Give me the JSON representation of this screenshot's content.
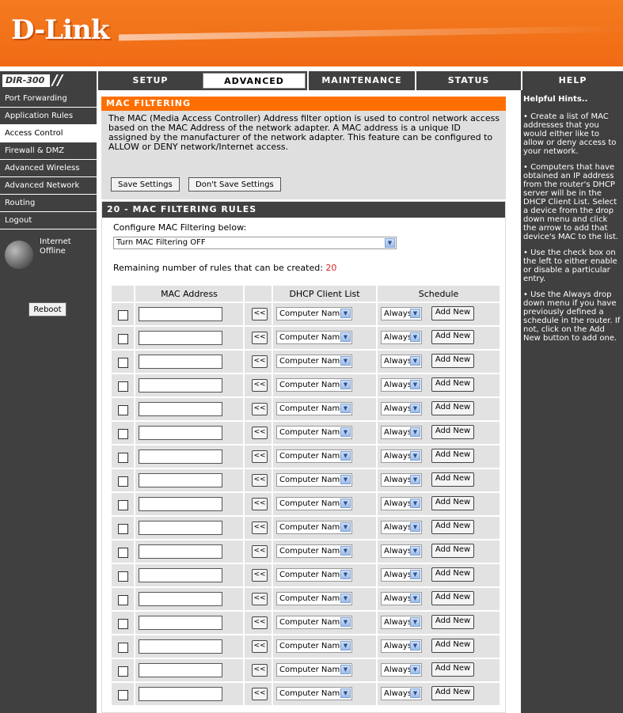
{
  "brand": {
    "logo": "D-Link",
    "model": "DIR-300"
  },
  "nav": {
    "tabs": [
      {
        "label": "SETUP",
        "active": false
      },
      {
        "label": "ADVANCED",
        "active": true
      },
      {
        "label": "MAINTENANCE",
        "active": false
      },
      {
        "label": "STATUS",
        "active": false
      },
      {
        "label": "HELP",
        "active": false
      }
    ]
  },
  "sidebar": {
    "items": [
      {
        "label": "Port Forwarding",
        "active": false
      },
      {
        "label": "Application Rules",
        "active": false
      },
      {
        "label": "Access Control",
        "active": true
      },
      {
        "label": "Firewall & DMZ",
        "active": false
      },
      {
        "label": "Advanced Wireless",
        "active": false
      },
      {
        "label": "Advanced Network",
        "active": false
      },
      {
        "label": "Routing",
        "active": false
      },
      {
        "label": "Logout",
        "active": false
      }
    ],
    "internet_status_line1": "Internet",
    "internet_status_line2": "Offline",
    "reboot_label": "Reboot"
  },
  "mac_filtering": {
    "title": "MAC FILTERING",
    "description": "The MAC (Media Access Controller) Address filter option is used to control network access based on the MAC Address of the network adapter. A MAC address is a unique ID assigned by the manufacturer of the network adapter. This feature can be configured to ALLOW or DENY network/Internet access.",
    "save_label": "Save Settings",
    "dont_save_label": "Don't Save Settings"
  },
  "rules": {
    "title": "20 - MAC FILTERING RULES",
    "config_label": "Configure MAC Filtering below:",
    "filter_mode": "Turn MAC Filtering OFF",
    "remaining_label": "Remaining number of rules that can be created:",
    "remaining_count": "20",
    "headers": {
      "mac": "MAC Address",
      "dhcp": "DHCP Client List",
      "schedule": "Schedule"
    },
    "row_defaults": {
      "copy": "<<",
      "dhcp": "Computer Name",
      "schedule": "Always",
      "add_new": "Add New"
    },
    "visible_rows": 17
  },
  "help": {
    "title": "Helpful Hints..",
    "hints": [
      "• Create a list of MAC addresses that you would either like to allow or deny access to your network.",
      "• Computers that have obtained an IP address from the router's DHCP server will be in the DHCP Client List. Select a device from the drop down menu and click the arrow to add that device's MAC to the list.",
      "• Use the check box on the left to either enable or disable a particular entry.",
      "• Use the Always drop down menu if you have previously defined a schedule in the router. If not, click on the Add New button to add one."
    ]
  },
  "colors": {
    "orange": "#ff6f00",
    "dark": "#404040",
    "panel": "#dfdfdf",
    "alert": "#e02020"
  }
}
